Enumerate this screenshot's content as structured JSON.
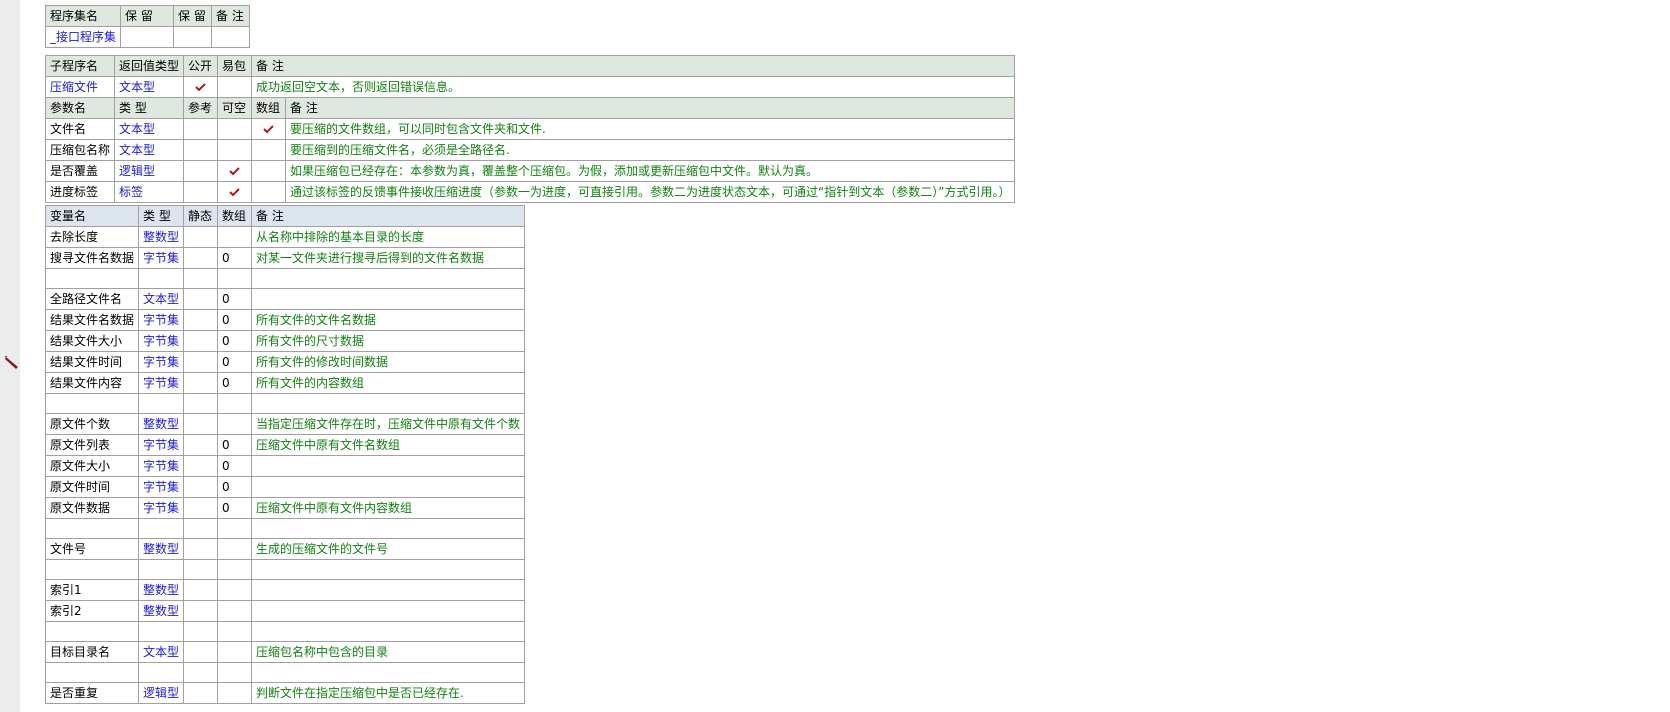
{
  "assembly_table": {
    "headers": [
      "程序集名",
      "保 留",
      "保 留",
      "备 注"
    ],
    "row": [
      "_接口程序集",
      "",
      "",
      ""
    ]
  },
  "sub_table": {
    "headers": [
      "子程序名",
      "返回值类型",
      "公开",
      "易包",
      "备 注"
    ],
    "row": {
      "name": "压缩文件",
      "return_type": "文本型",
      "public": true,
      "easy_pkg": false,
      "note": "成功返回空文本，否则返回错误信息。"
    }
  },
  "param_table": {
    "headers": [
      "参数名",
      "类 型",
      "参考",
      "可空",
      "数组",
      "备 注"
    ],
    "rows": [
      {
        "name": "文件名",
        "type": "文本型",
        "ref": false,
        "nullable": false,
        "array": true,
        "note": "要压缩的文件数组，可以同时包含文件夹和文件."
      },
      {
        "name": "压缩包名称",
        "type": "文本型",
        "ref": false,
        "nullable": false,
        "array": false,
        "note": "要压缩到的压缩文件名，必须是全路径名."
      },
      {
        "name": "是否覆盖",
        "type": "逻辑型",
        "ref": false,
        "nullable": true,
        "array": false,
        "note": "如果压缩包已经存在：本参数为真，覆盖整个压缩包。为假，添加或更新压缩包中文件。默认为真。"
      },
      {
        "name": "进度标签",
        "type": "标签",
        "ref": false,
        "nullable": true,
        "array": false,
        "note": "通过该标签的反馈事件接收压缩进度（参数一为进度，可直接引用。参数二为进度状态文本，可通过“指针到文本（参数二）”方式引用。）"
      }
    ]
  },
  "var_table": {
    "headers": [
      "变量名",
      "类 型",
      "静态",
      "数组",
      "备 注"
    ],
    "rows": [
      {
        "name": "去除长度",
        "type": "整数型",
        "static": "",
        "array": "",
        "note": "从名称中排除的基本目录的长度"
      },
      {
        "name": "搜寻文件名数据",
        "type": "字节集",
        "static": "",
        "array": "0",
        "note": "对某一文件夹进行搜寻后得到的文件名数据"
      },
      {
        "name": "",
        "type": "",
        "static": "",
        "array": "",
        "note": ""
      },
      {
        "name": "全路径文件名",
        "type": "文本型",
        "static": "",
        "array": "0",
        "note": ""
      },
      {
        "name": "结果文件名数据",
        "type": "字节集",
        "static": "",
        "array": "0",
        "note": "所有文件的文件名数据"
      },
      {
        "name": "结果文件大小",
        "type": "字节集",
        "static": "",
        "array": "0",
        "note": "所有文件的尺寸数据"
      },
      {
        "name": "结果文件时间",
        "type": "字节集",
        "static": "",
        "array": "0",
        "note": "所有文件的修改时间数据"
      },
      {
        "name": "结果文件内容",
        "type": "字节集",
        "static": "",
        "array": "0",
        "note": "所有文件的内容数组"
      },
      {
        "name": "",
        "type": "",
        "static": "",
        "array": "",
        "note": ""
      },
      {
        "name": "原文件个数",
        "type": "整数型",
        "static": "",
        "array": "",
        "note": "当指定压缩文件存在时，压缩文件中原有文件个数"
      },
      {
        "name": "原文件列表",
        "type": "字节集",
        "static": "",
        "array": "0",
        "note": "压缩文件中原有文件名数组"
      },
      {
        "name": "原文件大小",
        "type": "字节集",
        "static": "",
        "array": "0",
        "note": ""
      },
      {
        "name": "原文件时间",
        "type": "字节集",
        "static": "",
        "array": "0",
        "note": ""
      },
      {
        "name": "原文件数据",
        "type": "字节集",
        "static": "",
        "array": "0",
        "note": "压缩文件中原有文件内容数组"
      },
      {
        "name": "",
        "type": "",
        "static": "",
        "array": "",
        "note": ""
      },
      {
        "name": "文件号",
        "type": "整数型",
        "static": "",
        "array": "",
        "note": "生成的压缩文件的文件号"
      },
      {
        "name": "",
        "type": "",
        "static": "",
        "array": "",
        "note": ""
      },
      {
        "name": "索引1",
        "type": "整数型",
        "static": "",
        "array": "",
        "note": ""
      },
      {
        "name": "索引2",
        "type": "整数型",
        "static": "",
        "array": "",
        "note": ""
      },
      {
        "name": "",
        "type": "",
        "static": "",
        "array": "",
        "note": ""
      },
      {
        "name": "目标目录名",
        "type": "文本型",
        "static": "",
        "array": "",
        "note": "压缩包名称中包含的目录"
      },
      {
        "name": "",
        "type": "",
        "static": "",
        "array": "",
        "note": ""
      },
      {
        "name": "是否重复",
        "type": "逻辑型",
        "static": "",
        "array": "",
        "note": "判断文件在指定压缩包中是否已经存在."
      }
    ]
  },
  "icons": {
    "check": "checkmark-icon",
    "cursor": "pencil-cursor-icon"
  },
  "colors": {
    "type_text": "#1a1adc",
    "note_text": "#128012",
    "check": "#b01818",
    "header_bg": "#dfe8df",
    "var_header_bg": "#dce4ee"
  }
}
